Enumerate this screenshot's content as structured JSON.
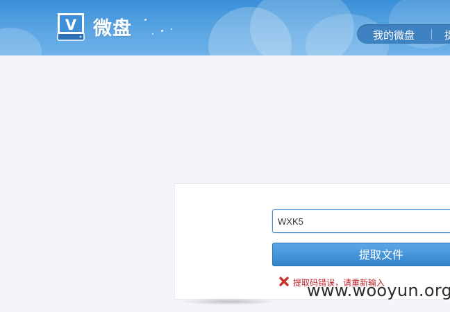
{
  "header": {
    "brand": "微盘",
    "logo_letter": "V",
    "nav": {
      "my_disk": "我的微盘",
      "next_partial": "提"
    }
  },
  "extract": {
    "code_value": "WXK5",
    "button_label": "提取文件",
    "error_message": "提取码错误，请重新输入"
  },
  "watermark": "www.wooyun.org",
  "colors": {
    "header_blue": "#4a9ae0",
    "button_blue": "#3584cc",
    "error_red": "#c0262c"
  }
}
